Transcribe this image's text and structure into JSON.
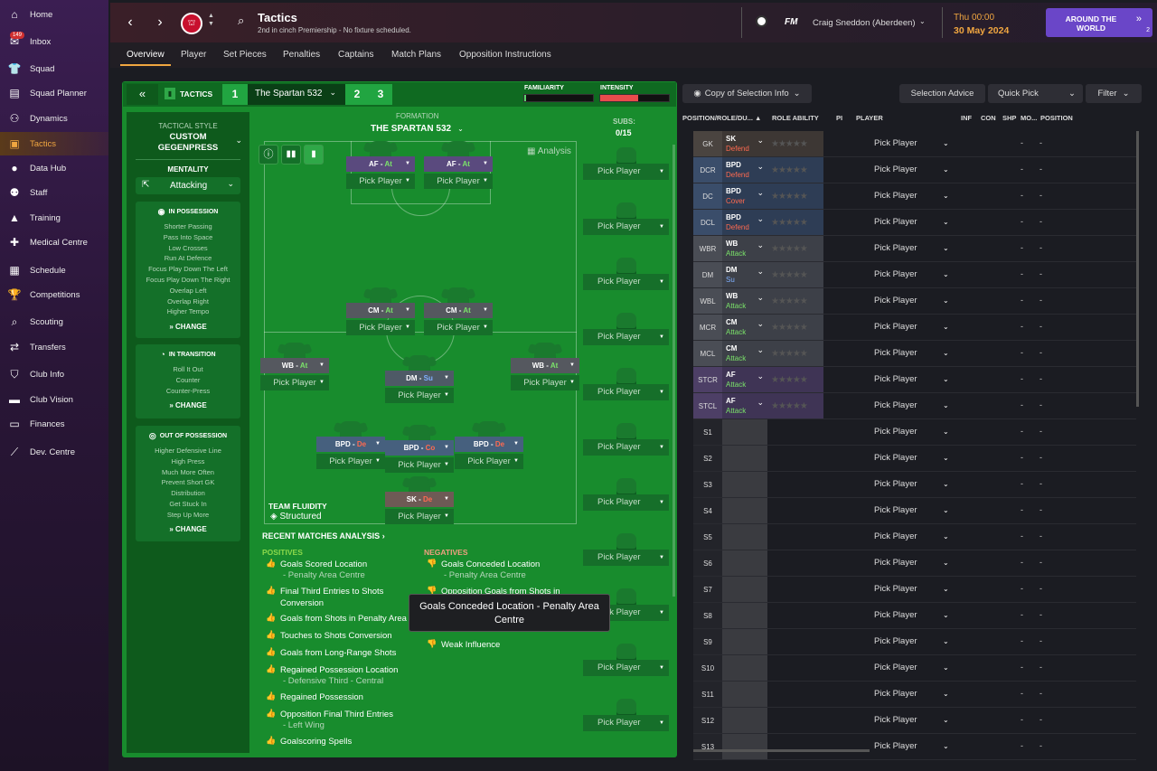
{
  "sidebar": {
    "items": [
      {
        "label": "Home",
        "icon": "home-icon",
        "glyph": "⌂"
      },
      {
        "label": "Inbox",
        "icon": "inbox-icon",
        "glyph": "✉",
        "badge": "149"
      },
      {
        "label": "Squad",
        "icon": "squad-icon",
        "glyph": "👕"
      },
      {
        "label": "Squad Planner",
        "icon": "squad-planner-icon",
        "glyph": "▤"
      },
      {
        "label": "Dynamics",
        "icon": "dynamics-icon",
        "glyph": "⚇"
      },
      {
        "label": "Tactics",
        "icon": "tactics-icon",
        "glyph": "▣"
      },
      {
        "label": "Data Hub",
        "icon": "data-hub-icon",
        "glyph": "●"
      },
      {
        "label": "Staff",
        "icon": "staff-icon",
        "glyph": "⚉"
      },
      {
        "label": "Training",
        "icon": "training-icon",
        "glyph": "▲"
      },
      {
        "label": "Medical Centre",
        "icon": "medical-centre-icon",
        "glyph": "✚"
      },
      {
        "label": "Schedule",
        "icon": "schedule-icon",
        "glyph": "▦"
      },
      {
        "label": "Competitions",
        "icon": "competitions-icon",
        "glyph": "🏆"
      },
      {
        "label": "Scouting",
        "icon": "scouting-icon",
        "glyph": "⌕"
      },
      {
        "label": "Transfers",
        "icon": "transfers-icon",
        "glyph": "⇄"
      },
      {
        "label": "Club Info",
        "icon": "club-info-icon",
        "glyph": "⛉"
      },
      {
        "label": "Club Vision",
        "icon": "club-vision-icon",
        "glyph": "▬"
      },
      {
        "label": "Finances",
        "icon": "finances-icon",
        "glyph": "▭"
      },
      {
        "label": "Dev. Centre",
        "icon": "dev-centre-icon",
        "glyph": "⟋"
      }
    ]
  },
  "header": {
    "title": "Tactics",
    "subtitle": "2nd in cinch Premiership - No fixture scheduled.",
    "fm": "FM",
    "manager": "Craig Sneddon (Aberdeen)",
    "day": "Thu 00:00",
    "date": "30 May 2024",
    "continue_label": "AROUND THE WORLD",
    "continue_count": "2"
  },
  "subnav": [
    "Overview",
    "Player",
    "Set Pieces",
    "Penalties",
    "Captains",
    "Match Plans",
    "Opposition Instructions"
  ],
  "tactic_bar": {
    "label": "TACTICS",
    "slot1": "1",
    "name": "The Spartan 532",
    "slot2": "2",
    "slot3": "3",
    "familiarity_label": "FAMILIARITY",
    "intensity_label": "INTENSITY",
    "familiarity": 0.02,
    "intensity": 0.55
  },
  "left": {
    "style_label": "TACTICAL STYLE",
    "style_value": "CUSTOM GEGENPRESS",
    "mentality_label": "MENTALITY",
    "mentality": "Attacking",
    "in_possession": {
      "title": "IN POSSESSION",
      "items": [
        "Shorter Passing",
        "Pass Into Space",
        "Low Crosses",
        "Run At Defence",
        "Focus Play Down The Left",
        "Focus Play Down The Right",
        "Overlap Left",
        "Overlap Right",
        "Higher Tempo"
      ]
    },
    "in_transition": {
      "title": "IN TRANSITION",
      "items": [
        "Roll It Out",
        "Counter",
        "Counter-Press"
      ]
    },
    "out_of_possession": {
      "title": "OUT OF POSSESSION",
      "items": [
        "Higher Defensive Line",
        "High Press",
        "Much More Often",
        "Prevent Short GK",
        "Distribution",
        "Get Stuck In",
        "Step Up More"
      ]
    },
    "change": "CHANGE"
  },
  "formation": {
    "label": "FORMATION",
    "name": "THE SPARTAN 532",
    "analysis": "Analysis",
    "subs_label": "SUBS:",
    "subs_count": "0/15",
    "team_fluidity_label": "TEAM FLUIDITY",
    "team_fluidity": "Structured",
    "pick_label": "Pick Player",
    "slots": [
      {
        "role": "AF",
        "sep": " - ",
        "duty": "At",
        "duty_color": "#7be36a"
      },
      {
        "role": "AF",
        "sep": " - ",
        "duty": "At",
        "duty_color": "#7be36a"
      },
      {
        "role": "CM",
        "sep": " - ",
        "duty": "At",
        "duty_color": "#7be36a"
      },
      {
        "role": "CM",
        "sep": " - ",
        "duty": "At",
        "duty_color": "#7be36a"
      },
      {
        "role": "WB",
        "sep": " - ",
        "duty": "At",
        "duty_color": "#7be36a"
      },
      {
        "role": "DM",
        "sep": " - ",
        "duty": "Su",
        "duty_color": "#7fb0ff"
      },
      {
        "role": "WB",
        "sep": " - ",
        "duty": "At",
        "duty_color": "#7be36a"
      },
      {
        "role": "BPD",
        "sep": " - ",
        "duty": "De",
        "duty_color": "#ff6a50"
      },
      {
        "role": "BPD",
        "sep": " - ",
        "duty": "Co",
        "duty_color": "#ff6a50"
      },
      {
        "role": "BPD",
        "sep": " - ",
        "duty": "De",
        "duty_color": "#ff6a50"
      },
      {
        "role": "SK",
        "sep": " - ",
        "duty": "De",
        "duty_color": "#ff6a50"
      }
    ]
  },
  "analysis": {
    "title": "RECENT MATCHES ANALYSIS",
    "positives_label": "POSITIVES",
    "negatives_label": "NEGATIVES",
    "positives": [
      {
        "text": "Goals Scored Location",
        "sub": "- Penalty Area Centre"
      },
      {
        "text": "Final Third Entries to Shots Conversion",
        "sub": ""
      },
      {
        "text": "Goals from Shots in Penalty Area",
        "sub": ""
      },
      {
        "text": "Touches to Shots Conversion",
        "sub": ""
      },
      {
        "text": "Goals from Long-Range Shots",
        "sub": ""
      },
      {
        "text": "Regained Possession Location",
        "sub": "- Defensive Third - Central"
      },
      {
        "text": "Regained Possession",
        "sub": ""
      },
      {
        "text": "Opposition Final Third Entries",
        "sub": "- Left Wing"
      },
      {
        "text": "Goalscoring Spells",
        "sub": ""
      }
    ],
    "negatives": [
      {
        "text": "Goals Conceded Location",
        "sub": "- Penalty Area Centre"
      },
      {
        "text": "Opposition Goals from Shots in",
        "sub": ""
      },
      {
        "text": "Weak Influence",
        "sub": ""
      }
    ],
    "tooltip": "Goals Conceded Location - Penalty Area Centre"
  },
  "right": {
    "copy_label": "Copy of Selection Info",
    "selection_advice": "Selection Advice",
    "quick_pick": "Quick Pick",
    "filter": "Filter",
    "columns": {
      "pos": "POSITION/ROLE/DU...",
      "role_ability": "ROLE ABILITY",
      "pi": "PI",
      "player": "PLAYER",
      "inf": "INF",
      "con": "CON",
      "shp": "SHP",
      "mo": "MO...",
      "position": "POSITION"
    },
    "pick_label": "Pick Player",
    "dash": "-",
    "rows": [
      {
        "pos": "GK",
        "role": "SK",
        "duty": "Defend",
        "duty_color": "#ff6a50",
        "bg": "#4a4440",
        "rbg": "#3d3734"
      },
      {
        "pos": "DCR",
        "role": "BPD",
        "duty": "Defend",
        "duty_color": "#ff6a50",
        "bg": "#3a4d6a",
        "rbg": "#2e3d55"
      },
      {
        "pos": "DC",
        "role": "BPD",
        "duty": "Cover",
        "duty_color": "#ff6a50",
        "bg": "#3a4d6a",
        "rbg": "#2e3d55"
      },
      {
        "pos": "DCL",
        "role": "BPD",
        "duty": "Defend",
        "duty_color": "#ff6a50",
        "bg": "#3a4d6a",
        "rbg": "#2e3d55"
      },
      {
        "pos": "WBR",
        "role": "WB",
        "duty": "Attack",
        "duty_color": "#7be36a",
        "bg": "#4a4d55",
        "rbg": "#3d4048"
      },
      {
        "pos": "DM",
        "role": "DM",
        "duty": "Su",
        "duty_color": "#7fb0ff",
        "bg": "#4a4d55",
        "rbg": "#3d4048"
      },
      {
        "pos": "WBL",
        "role": "WB",
        "duty": "Attack",
        "duty_color": "#7be36a",
        "bg": "#4a4d55",
        "rbg": "#3d4048"
      },
      {
        "pos": "MCR",
        "role": "CM",
        "duty": "Attack",
        "duty_color": "#7be36a",
        "bg": "#4a4d55",
        "rbg": "#3d4048"
      },
      {
        "pos": "MCL",
        "role": "CM",
        "duty": "Attack",
        "duty_color": "#7be36a",
        "bg": "#4a4d55",
        "rbg": "#3d4048"
      },
      {
        "pos": "STCR",
        "role": "AF",
        "duty": "Attack",
        "duty_color": "#7be36a",
        "bg": "#4d3f66",
        "rbg": "#3f3455"
      },
      {
        "pos": "STCL",
        "role": "AF",
        "duty": "Attack",
        "duty_color": "#7be36a",
        "bg": "#4d3f66",
        "rbg": "#3f3455"
      },
      {
        "pos": "S1"
      },
      {
        "pos": "S2"
      },
      {
        "pos": "S3"
      },
      {
        "pos": "S4"
      },
      {
        "pos": "S5"
      },
      {
        "pos": "S6"
      },
      {
        "pos": "S7"
      },
      {
        "pos": "S8"
      },
      {
        "pos": "S9"
      },
      {
        "pos": "S10"
      },
      {
        "pos": "S11"
      },
      {
        "pos": "S12"
      },
      {
        "pos": "S13"
      }
    ]
  },
  "colors": {
    "accent": "#f0a640",
    "pitch": "#188c2d",
    "purple_button": "#6a46c8"
  }
}
